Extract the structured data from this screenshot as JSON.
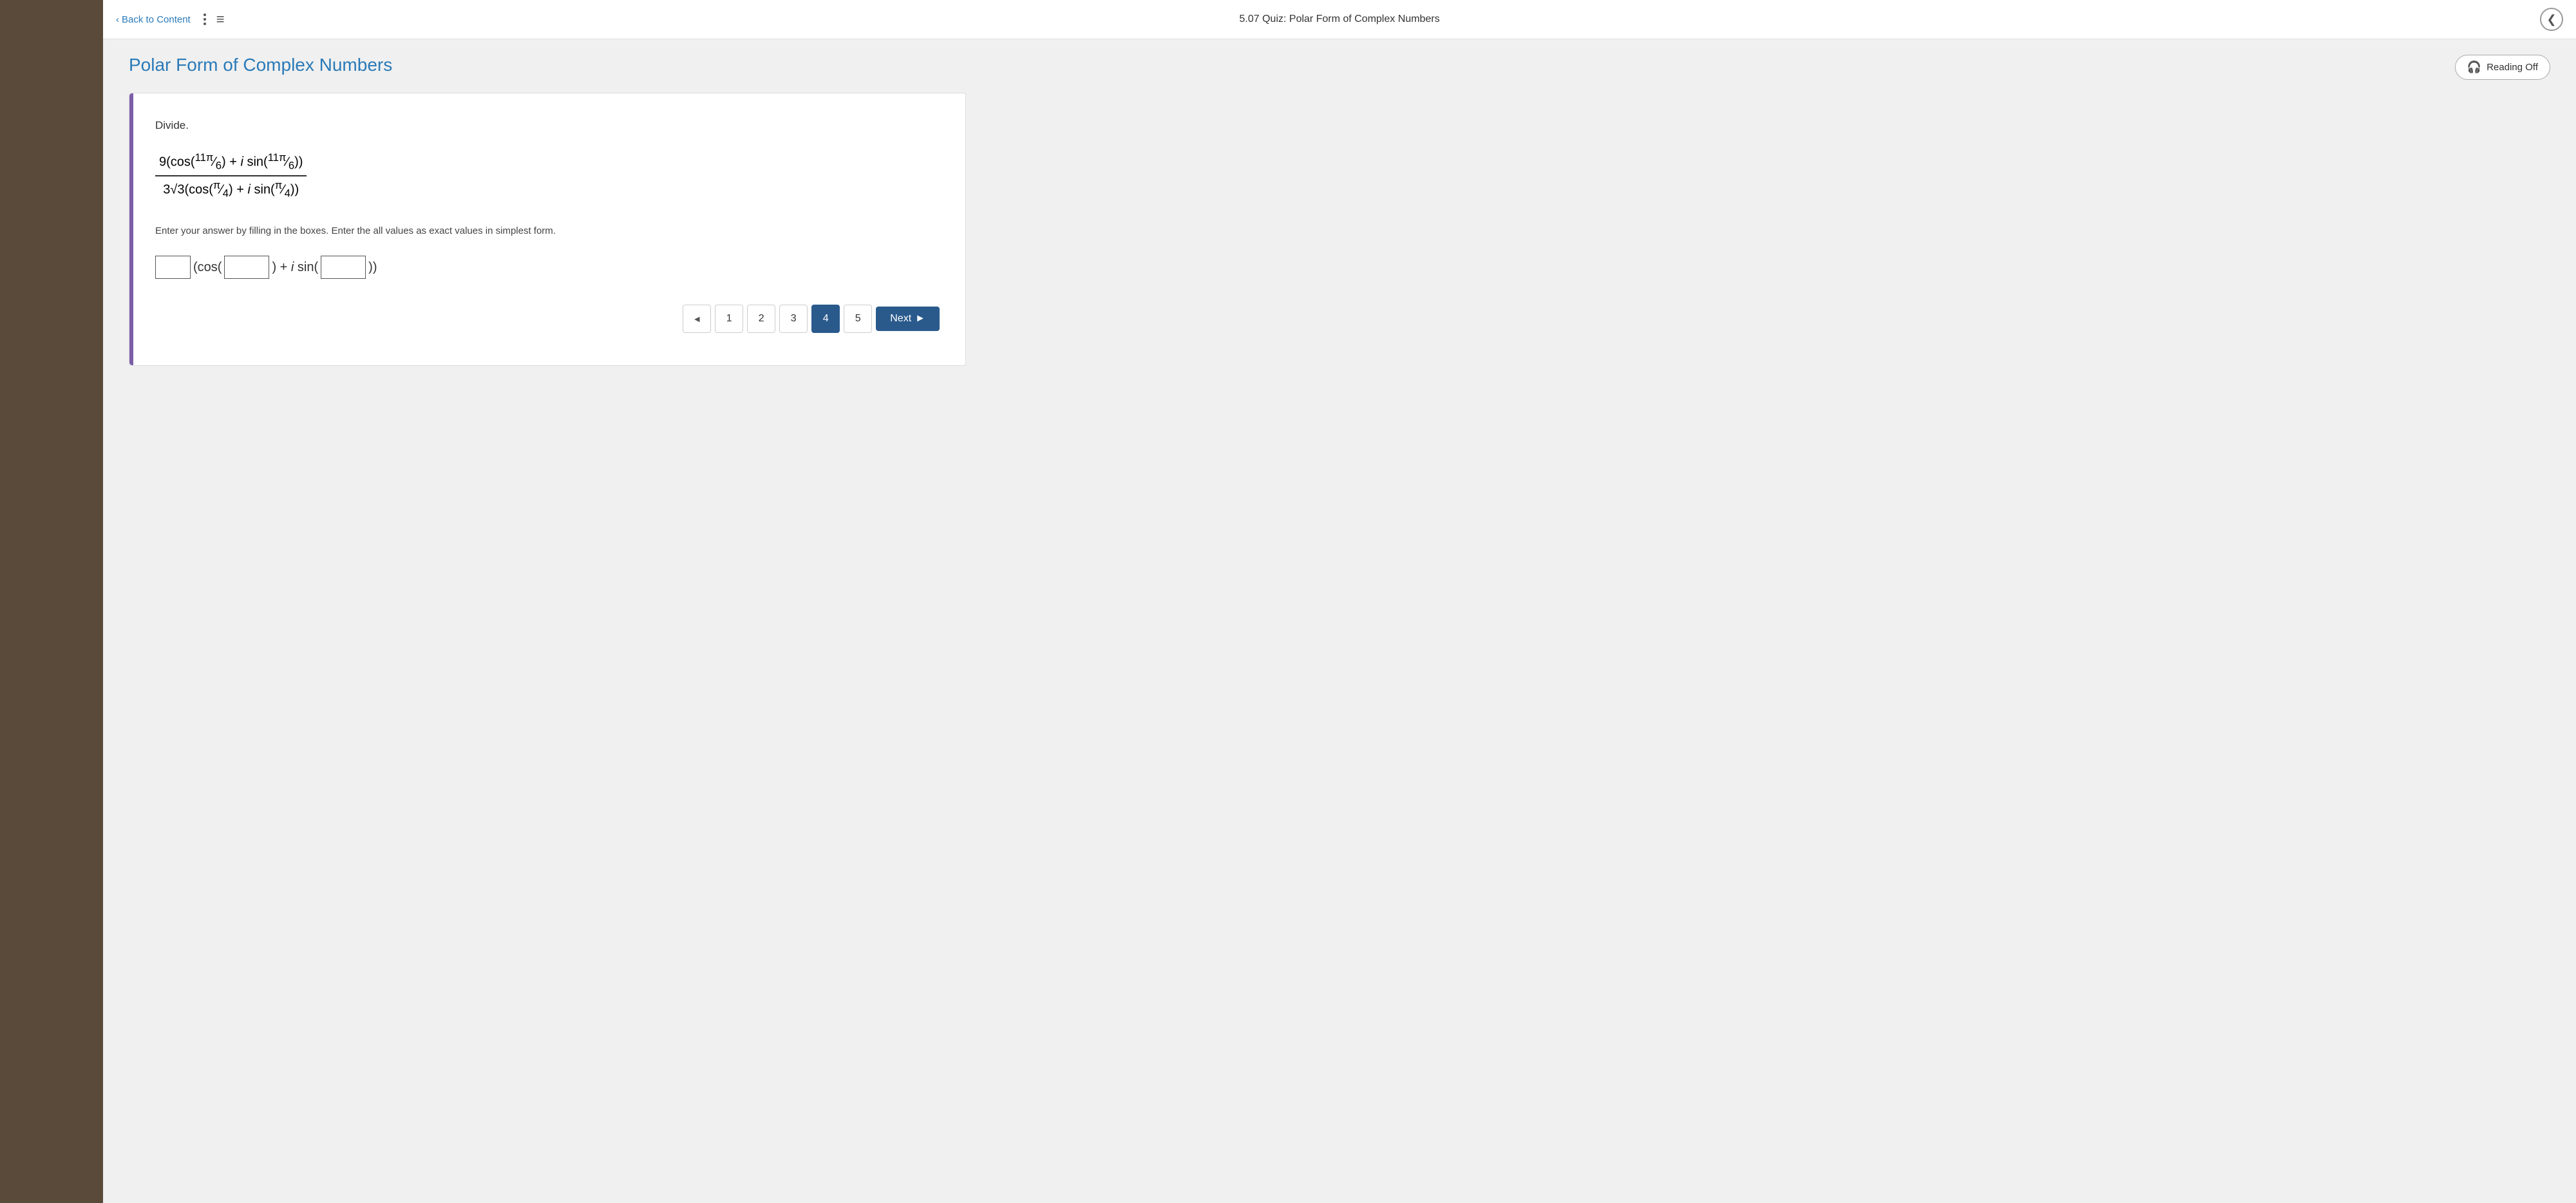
{
  "header": {
    "back_label": "Back to Content",
    "quiz_title": "5.07 Quiz: Polar Form of Complex Numbers",
    "back_arrow": "‹"
  },
  "reading": {
    "label": "Reading  Off"
  },
  "page": {
    "title": "Polar Form of Complex Numbers",
    "question_label": "Divide.",
    "instruction": "Enter your answer by filling in the boxes. Enter the all values as exact values in simplest form.",
    "fraction": {
      "numerator": "9(cos(11π/6) + i sin(11π/6))",
      "denominator": "3√3(cos(π/4) + i sin(π/4))"
    },
    "answer_prefix": "",
    "answer_format": "[ ](cos([ ]) + i sin([ ]))"
  },
  "pagination": {
    "prev_arrow": "◄",
    "pages": [
      "1",
      "2",
      "3",
      "4",
      "5"
    ],
    "active_page": "4",
    "next_label": "Next",
    "next_arrow": "►"
  },
  "icons": {
    "back_chevron": "‹",
    "headphone": "🎧",
    "dots_vertical": "⋮",
    "hamburger": "≡",
    "circle_back": "❮"
  }
}
